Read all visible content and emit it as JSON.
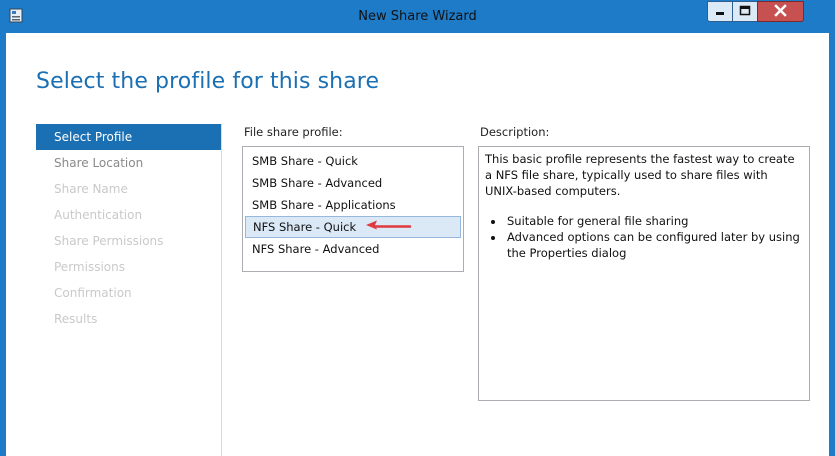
{
  "window": {
    "title": "New Share Wizard"
  },
  "page": {
    "title": "Select the profile for this share"
  },
  "nav": [
    {
      "label": "Select Profile",
      "state": "active"
    },
    {
      "label": "Share Location",
      "state": "enabled"
    },
    {
      "label": "Share Name",
      "state": "disabled"
    },
    {
      "label": "Authentication",
      "state": "disabled"
    },
    {
      "label": "Share Permissions",
      "state": "disabled"
    },
    {
      "label": "Permissions",
      "state": "disabled"
    },
    {
      "label": "Confirmation",
      "state": "disabled"
    },
    {
      "label": "Results",
      "state": "disabled"
    }
  ],
  "profiles": {
    "label": "File share profile:",
    "items": [
      "SMB Share - Quick",
      "SMB Share - Advanced",
      "SMB Share - Applications",
      "NFS Share - Quick",
      "NFS Share - Advanced"
    ],
    "selected": "NFS Share - Quick"
  },
  "description": {
    "label": "Description:",
    "text": "This basic profile represents the fastest way to create a NFS file share, typically used to share files with UNIX-based computers.",
    "bullets": [
      "Suitable for general file sharing",
      "Advanced options can be configured later by using the Properties dialog"
    ]
  },
  "colors": {
    "accent": "#1b6fb3",
    "titlebar": "#1e7bc8",
    "close_button": "#c75050",
    "annotation_arrow": "#e0393e"
  },
  "icons": {
    "app": "server-manager-icon",
    "minimize": "minimize-icon",
    "maximize": "maximize-icon",
    "close": "close-icon",
    "annotation": "red-arrow-annotation"
  }
}
